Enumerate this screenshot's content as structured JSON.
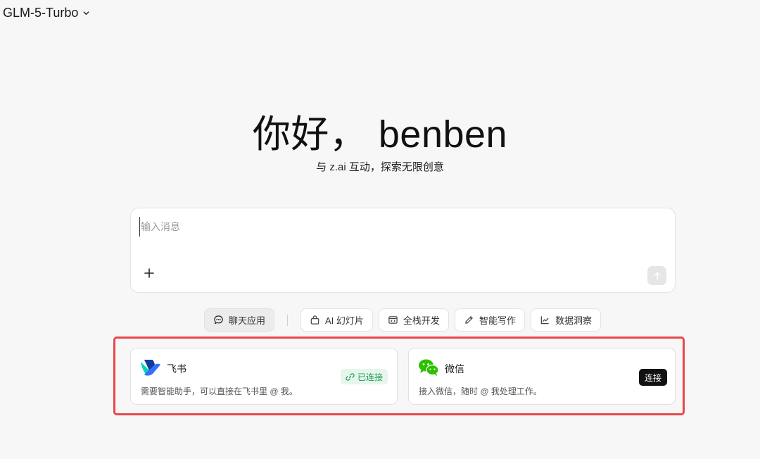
{
  "header": {
    "model_name": "GLM-5-Turbo"
  },
  "hero": {
    "greeting": "你好， benben",
    "subtitle": "与 z.ai 互动，探索无限创意"
  },
  "composer": {
    "placeholder": "输入消息",
    "value": ""
  },
  "chips": [
    {
      "label": "聊天应用",
      "icon": "chat-bubble-icon",
      "active": true
    },
    {
      "label": "AI 幻灯片",
      "icon": "presentation-icon"
    },
    {
      "label": "全栈开发",
      "icon": "code-window-icon"
    },
    {
      "label": "智能写作",
      "icon": "pen-icon"
    },
    {
      "label": "数据洞察",
      "icon": "trend-chart-icon"
    }
  ],
  "integrations": [
    {
      "name": "飞书",
      "desc": "需要智能助手，可以直接在飞书里 @ 我。",
      "status": "已连接",
      "icon": "feishu-logo"
    },
    {
      "name": "微信",
      "desc": "接入微信，随时 @ 我处理工作。",
      "action": "连接",
      "icon": "wechat-logo"
    }
  ],
  "colors": {
    "highlight": "#e8474a",
    "connected": "#1f9d55",
    "connected_bg": "#e6f6ec",
    "wechat": "#2dc100",
    "feishu_blue": "#3370ff"
  }
}
